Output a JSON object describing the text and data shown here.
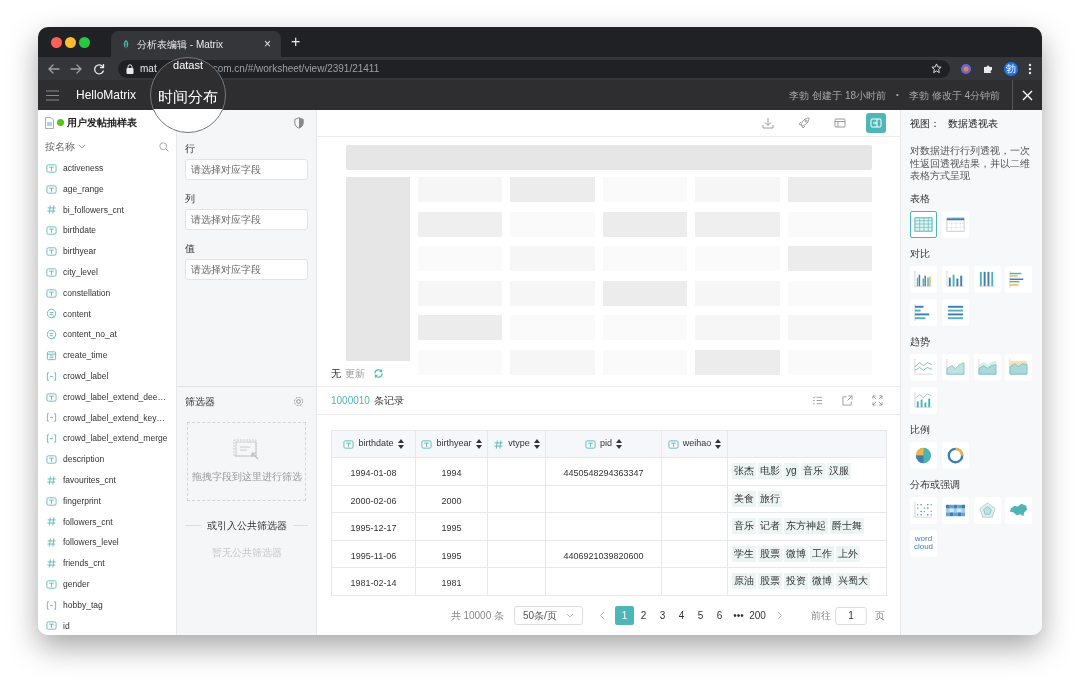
{
  "browser": {
    "tab_title": "分析表编辑 - Matrix",
    "tab_close": "×",
    "new_tab": "+",
    "url_start": "mat",
    "url_rest": "com.cn/#/worksheet/view/2391/21411",
    "profile_initial": "勃"
  },
  "magnifier": {
    "fragment": "datast",
    "text": "时间分布"
  },
  "app_header": {
    "brand": "HelloMatrix",
    "created": "李勃 创建于 18小时前",
    "separator": "•",
    "modified": "李勃 修改于 4分钟前"
  },
  "sidebar": {
    "table_name": "用户发帖抽样表",
    "sort_label": "按名称",
    "fields": [
      {
        "name": "activeness",
        "kind": "str"
      },
      {
        "name": "age_range",
        "kind": "str"
      },
      {
        "name": "bi_followers_cnt",
        "kind": "num"
      },
      {
        "name": "birthdate",
        "kind": "str"
      },
      {
        "name": "birthyear",
        "kind": "str"
      },
      {
        "name": "city_level",
        "kind": "str"
      },
      {
        "name": "constellation",
        "kind": "str"
      },
      {
        "name": "content",
        "kind": "text"
      },
      {
        "name": "content_no_at",
        "kind": "text"
      },
      {
        "name": "create_time",
        "kind": "date"
      },
      {
        "name": "crowd_label",
        "kind": "arr"
      },
      {
        "name": "crowd_label_extend_dee…",
        "kind": "str"
      },
      {
        "name": "crowd_label_extend_key…",
        "kind": "arr"
      },
      {
        "name": "crowd_label_extend_merge",
        "kind": "arr"
      },
      {
        "name": "description",
        "kind": "str"
      },
      {
        "name": "favourites_cnt",
        "kind": "num"
      },
      {
        "name": "fingerprint",
        "kind": "str"
      },
      {
        "name": "followers_cnt",
        "kind": "num"
      },
      {
        "name": "followers_level",
        "kind": "num"
      },
      {
        "name": "friends_cnt",
        "kind": "num"
      },
      {
        "name": "gender",
        "kind": "str"
      },
      {
        "name": "hobby_tag",
        "kind": "arr"
      },
      {
        "name": "id",
        "kind": "str"
      }
    ]
  },
  "config": {
    "slots": [
      {
        "label": "行",
        "placeholder": "请选择对应字段"
      },
      {
        "label": "列",
        "placeholder": "请选择对应字段"
      },
      {
        "label": "值",
        "placeholder": "请选择对应字段"
      }
    ],
    "filter": {
      "title": "筛选器",
      "drop_hint": "拖拽字段到这里进行筛选",
      "public_heading": "或引入公共筛选器",
      "public_empty": "暂无公共筛选器"
    }
  },
  "preview": {
    "toolbar": [
      {
        "kind": "download",
        "selected": false
      },
      {
        "kind": "rocket",
        "selected": false
      },
      {
        "kind": "table",
        "selected": false
      },
      {
        "kind": "panel",
        "selected": true
      }
    ],
    "status": "无",
    "update": "更新"
  },
  "records": {
    "count": "1000010",
    "suffix": "条记录",
    "columns": [
      {
        "name": "birthdate",
        "kind": "str"
      },
      {
        "name": "birthyear",
        "kind": "str"
      },
      {
        "name": "vtype",
        "kind": "num"
      },
      {
        "name": "pid",
        "kind": "str"
      },
      {
        "name": "weihao",
        "kind": "str"
      }
    ],
    "rows": [
      {
        "cells": {
          "birthdate": "1994-01-08",
          "birthyear": "1994",
          "pid": "4450548294363347"
        },
        "tags": [
          "张杰",
          "电影",
          "yg",
          "音乐",
          "汉服"
        ]
      },
      {
        "cells": {
          "birthdate": "2000-02-06",
          "birthyear": "2000"
        },
        "tags": [
          "美食",
          "旅行"
        ]
      },
      {
        "cells": {
          "birthdate": "1995-12-17",
          "birthyear": "1995"
        },
        "tags": [
          "音乐",
          "记者",
          "东方神起",
          "爵士舞"
        ]
      },
      {
        "cells": {
          "birthdate": "1995-11-06",
          "birthyear": "1995",
          "pid": "4406921039820600"
        },
        "tags": [
          "学生",
          "股票",
          "微博",
          "工作",
          "上外"
        ]
      },
      {
        "cells": {
          "birthdate": "1981-02-14",
          "birthyear": "1981"
        },
        "tags": [
          "原油",
          "股票",
          "投资",
          "微博",
          "兴蜀大"
        ]
      }
    ],
    "pagination": {
      "total": "共 10000 条",
      "page_size": "50条/页",
      "pages": [
        {
          "label": "1",
          "selected": true
        },
        {
          "label": "2",
          "selected": false
        },
        {
          "label": "3",
          "selected": false
        },
        {
          "label": "4",
          "selected": false
        },
        {
          "label": "5",
          "selected": false
        },
        {
          "label": "6",
          "selected": false
        },
        {
          "label": "•••",
          "selected": false
        },
        {
          "label": "200",
          "selected": false
        }
      ],
      "goto_label": "前往",
      "goto_value": "1",
      "goto_suffix": "页"
    }
  },
  "view_panel": {
    "view_label": "视图：",
    "view_name": "数据透视表",
    "description": "对数据进行行列透视，一次性返回透视结果，并以二维表格方式呈现",
    "groups": [
      {
        "title": "表格",
        "charts": [
          {
            "kind": "table",
            "selected": true
          },
          {
            "kind": "crosstab",
            "selected": false
          }
        ]
      },
      {
        "title": "对比",
        "charts": [
          {
            "kind": "bar_grouped",
            "selected": false
          },
          {
            "kind": "bar",
            "selected": false
          },
          {
            "kind": "bar_stacked",
            "selected": false
          },
          {
            "kind": "hbar_grouped",
            "selected": false
          },
          {
            "kind": "hbar",
            "selected": false
          },
          {
            "kind": "hbar_stacked",
            "selected": false
          }
        ]
      },
      {
        "title": "趋势",
        "charts": [
          {
            "kind": "line",
            "selected": false
          },
          {
            "kind": "area",
            "selected": false
          },
          {
            "kind": "area_stacked",
            "selected": false
          },
          {
            "kind": "area_colored",
            "selected": false
          },
          {
            "kind": "combo",
            "selected": false
          }
        ]
      },
      {
        "title": "比例",
        "charts": [
          {
            "kind": "pie",
            "selected": false
          },
          {
            "kind": "donut",
            "selected": false
          }
        ]
      },
      {
        "title": "分布或强调",
        "charts": [
          {
            "kind": "scatter",
            "selected": false
          },
          {
            "kind": "heatmap",
            "selected": false
          },
          {
            "kind": "radar",
            "selected": false
          },
          {
            "kind": "map",
            "selected": false
          },
          {
            "kind": "wordcloud",
            "selected": false,
            "text": "word cloud"
          }
        ]
      }
    ]
  }
}
